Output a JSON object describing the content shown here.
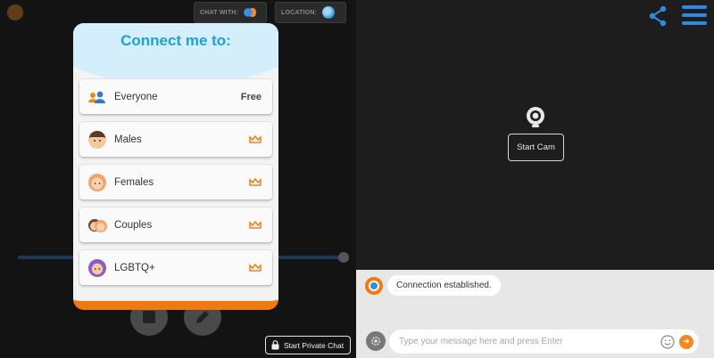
{
  "topbar": {
    "chat_with_label": "CHAT WITH:",
    "location_label": "LOCATION:"
  },
  "modal": {
    "title": "Connect me to:",
    "options": [
      {
        "label": "Everyone",
        "badge": "Free",
        "icon": "group-icon"
      },
      {
        "label": "Males",
        "icon": "male-avatar-icon",
        "premium": true
      },
      {
        "label": "Females",
        "icon": "female-avatar-icon",
        "premium": true
      },
      {
        "label": "Couples",
        "icon": "couple-avatar-icon",
        "premium": true
      },
      {
        "label": "LGBTQ+",
        "icon": "lgbtq-avatar-icon",
        "premium": true
      }
    ]
  },
  "left_controls": {
    "private_chat_label": "Start Private Chat"
  },
  "camera": {
    "start_cam_label": "Start Cam"
  },
  "chat": {
    "system_message": "Connection established.",
    "input_placeholder": "Type your message here and press Enter"
  },
  "colors": {
    "accent_blue": "#1fa0d8",
    "accent_orange": "#f07a12",
    "crown_orange": "#f0871e"
  }
}
